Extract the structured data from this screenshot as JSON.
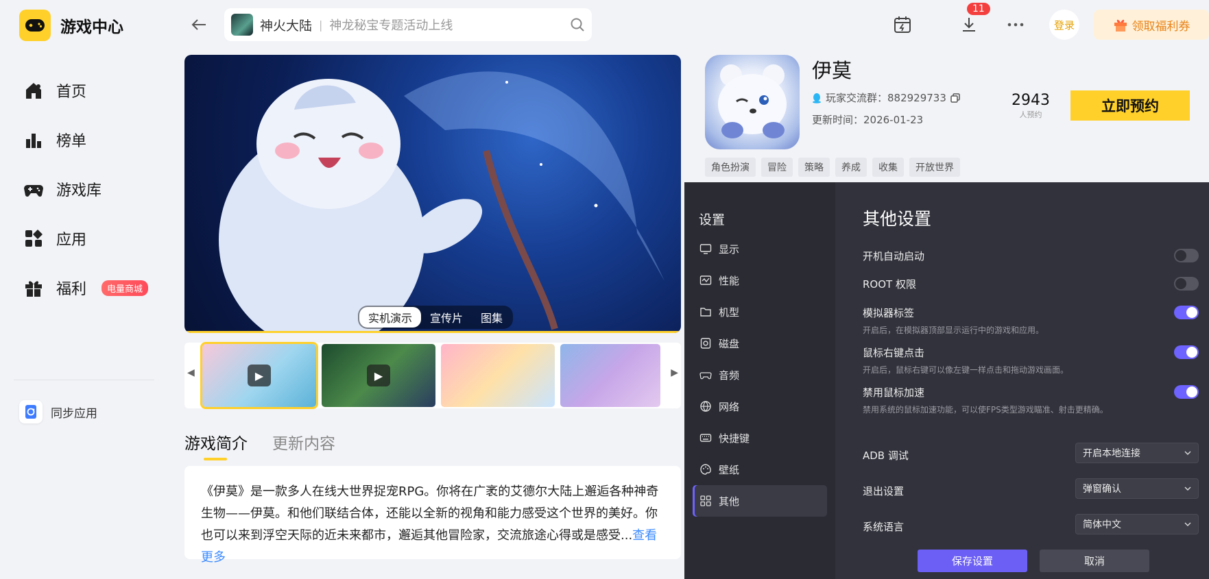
{
  "app": {
    "title": "游戏中心"
  },
  "nav": {
    "items": [
      {
        "label": "首页",
        "icon": "home-icon"
      },
      {
        "label": "榜单",
        "icon": "ranking-icon"
      },
      {
        "label": "游戏库",
        "icon": "gamepad-icon"
      },
      {
        "label": "应用",
        "icon": "apps-icon"
      },
      {
        "label": "福利",
        "icon": "gift-icon",
        "badge": "电量商城"
      }
    ],
    "sync_label": "同步应用"
  },
  "search": {
    "game": "神火大陆",
    "hint": "神龙秘宝专题活动上线"
  },
  "topbar": {
    "download_count": "11",
    "login": "登录",
    "coupon": "领取福利券"
  },
  "hero": {
    "tabs": [
      "实机演示",
      "宣传片",
      "图集"
    ],
    "active_tab": 0
  },
  "detail_tabs": [
    "游戏简介",
    "更新内容"
  ],
  "description": {
    "text": "《伊莫》是一款多人在线大世界捉宠RPG。你将在广袤的艾德尔大陆上邂逅各种神奇生物——伊莫。和他们联结合体，还能以全新的视角和能力感受这个世界的美好。你也可以来到浮空天际的近未来都市，邂逅其他冒险家，交流旅途心得或是感受...",
    "more": "查看更多"
  },
  "game": {
    "name": "伊莫",
    "qq_group": "玩家交流群：882929733",
    "update_time": "更新时间：2026-01-23",
    "reserve_count": "2943",
    "reserve_count_label": "人预约",
    "reserve_button": "立即预约",
    "tags": [
      "角色扮演",
      "冒险",
      "策略",
      "养成",
      "收集",
      "开放世界"
    ]
  },
  "settings": {
    "title": "设置",
    "menu": [
      "显示",
      "性能",
      "机型",
      "磁盘",
      "音频",
      "网络",
      "快捷键",
      "壁纸",
      "其他"
    ],
    "active_menu": 8,
    "heading": "其他设置",
    "toggles": [
      {
        "label": "开机自动启动",
        "desc": "",
        "on": false
      },
      {
        "label": "ROOT 权限",
        "desc": "",
        "on": false
      },
      {
        "label": "模拟器标签",
        "desc": "开启后，在模拟器顶部显示运行中的游戏和应用。",
        "on": true
      },
      {
        "label": "鼠标右键点击",
        "desc": "开启后，鼠标右键可以像左键一样点击和拖动游戏画面。",
        "on": true
      },
      {
        "label": "禁用鼠标加速",
        "desc": "禁用系统的鼠标加速功能，可以使FPS类型游戏瞄准、射击更精确。",
        "on": true
      }
    ],
    "selects": [
      {
        "label": "ADB 调试",
        "value": "开启本地连接"
      },
      {
        "label": "退出设置",
        "value": "弹窗确认"
      },
      {
        "label": "系统语言",
        "value": "简体中文"
      }
    ],
    "save": "保存设置",
    "cancel": "取消"
  },
  "colors": {
    "accent": "#ffd02a",
    "settings_accent": "#6c5ff5",
    "badge_red": "#f43f3f"
  }
}
